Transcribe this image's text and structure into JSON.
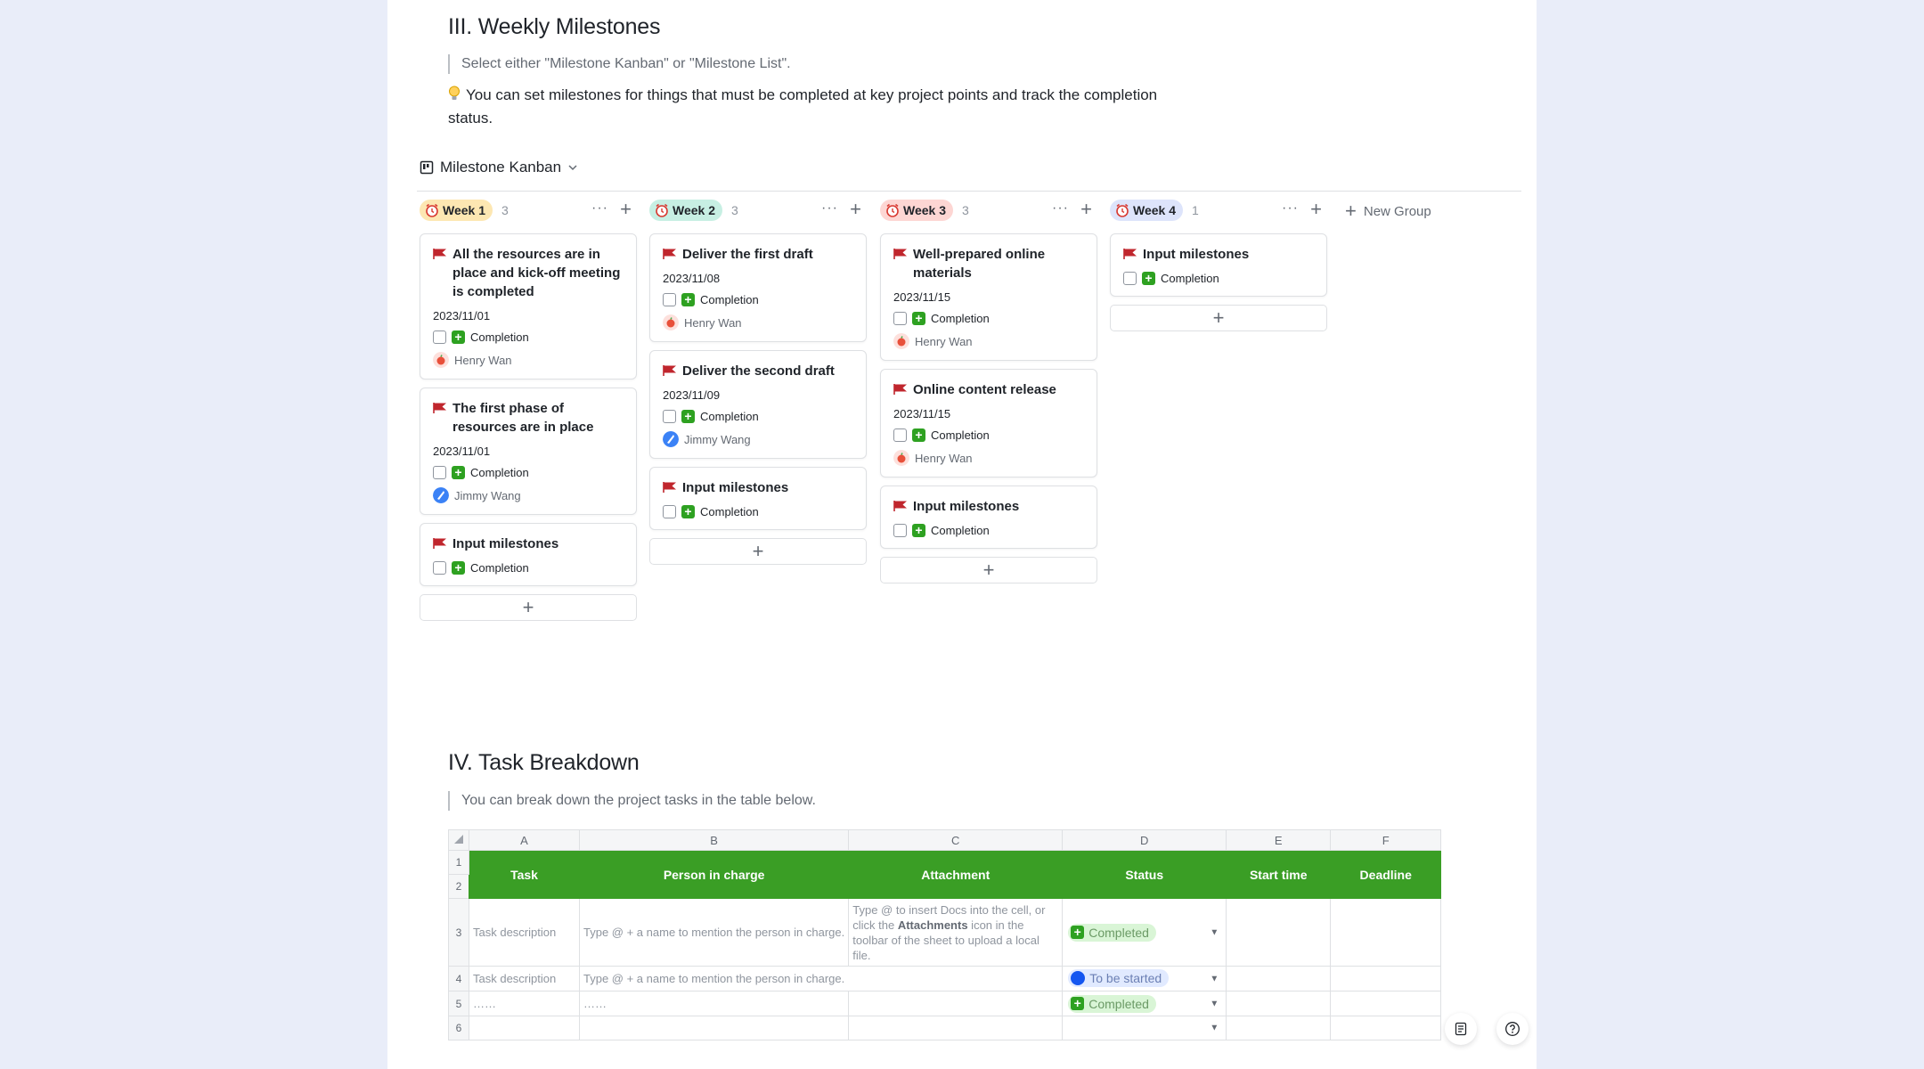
{
  "section3": {
    "title": "III. Weekly Milestones",
    "quote": "Select either \"Milestone Kanban\" or \"Milestone List\".",
    "tip": "You can set milestones for things that must be completed at key project points and track the completion status."
  },
  "kanban": {
    "view_name": "Milestone Kanban",
    "new_group_label": "New Group",
    "columns": [
      {
        "label": "Week 1",
        "count": "3",
        "color": "#fde7b2",
        "cards": [
          {
            "title": "All the resources are in place and kick-off meeting is completed",
            "date": "2023/11/01",
            "check_label": "Completion",
            "person": "Henry Wan"
          },
          {
            "title": "The first phase of resources are in place",
            "date": "2023/11/01",
            "check_label": "Completion",
            "person": "Jimmy Wang"
          },
          {
            "title": "Input milestones",
            "check_label": "Completion"
          }
        ]
      },
      {
        "label": "Week 2",
        "count": "3",
        "color": "#c7efe3",
        "cards": [
          {
            "title": "Deliver the first draft",
            "date": "2023/11/08",
            "check_label": "Completion",
            "person": "Henry Wan"
          },
          {
            "title": "Deliver the second draft",
            "date": "2023/11/09",
            "check_label": "Completion",
            "person": "Jimmy Wang"
          },
          {
            "title": "Input milestones",
            "check_label": "Completion"
          }
        ]
      },
      {
        "label": "Week 3",
        "count": "3",
        "color": "#fdd6d3",
        "cards": [
          {
            "title": "Well-prepared online materials",
            "date": "2023/11/15",
            "check_label": "Completion",
            "person": "Henry Wan"
          },
          {
            "title": "Online content release",
            "date": "2023/11/15",
            "check_label": "Completion",
            "person": "Henry Wan"
          },
          {
            "title": "Input milestones",
            "check_label": "Completion"
          }
        ]
      },
      {
        "label": "Week 4",
        "count": "1",
        "color": "#dde4fb",
        "cards": [
          {
            "title": "Input milestones",
            "check_label": "Completion"
          }
        ]
      }
    ]
  },
  "section4": {
    "title": "IV. Task Breakdown",
    "quote": "You can break down the project tasks in the table below."
  },
  "sheet": {
    "col_letters": [
      "A",
      "B",
      "C",
      "D",
      "E",
      "F"
    ],
    "headers": [
      "Task",
      "Person in charge",
      "Attachment",
      "Status",
      "Start time",
      "Deadline"
    ],
    "row_numbers": [
      "1",
      "2",
      "3",
      "4",
      "5",
      "6"
    ],
    "rows": [
      {
        "task": "Task description",
        "person": "Type @ + a name to mention the person in charge.",
        "attach_pre": "Type @ to insert Docs into the cell, or click the ",
        "attach_bold": "Attachments",
        "attach_post": " icon in the toolbar of the sheet to upload a local file.",
        "status": "Completed"
      },
      {
        "task": "Task description",
        "person": "Type @ + a name to mention the person in charge.",
        "status": "To be started"
      },
      {
        "task": "……",
        "person": "……",
        "status": "Completed"
      }
    ]
  },
  "colors": {
    "accent_green": "#3a9e25",
    "flag_red": "#c0262d",
    "page_bg": "#e9edf9"
  }
}
